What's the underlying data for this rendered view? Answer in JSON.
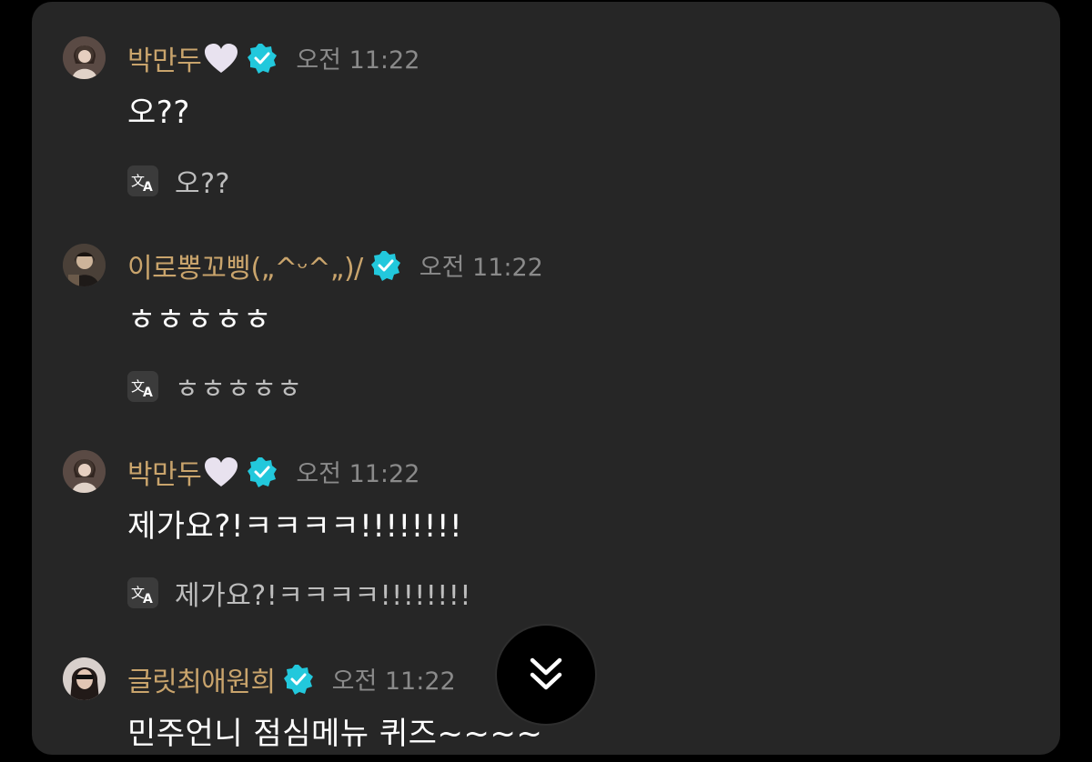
{
  "colors": {
    "background": "#000000",
    "panel": "#262626",
    "username": "#c9a46c",
    "timestamp": "#8a8a8a",
    "message": "#ffffff",
    "translation": "#bdbdbd",
    "verified_badge": "#22c8dc"
  },
  "messages": [
    {
      "username": "박만두",
      "has_heart": true,
      "verified": true,
      "time": "오전 11:22",
      "text": "오??",
      "translation": "오??"
    },
    {
      "username": "이로뽕꼬삥(„^ᵕ^„)/",
      "has_heart": false,
      "verified": true,
      "time": "오전 11:22",
      "text": "ㅎㅎㅎㅎㅎ",
      "translation": "ㅎㅎㅎㅎㅎ"
    },
    {
      "username": "박만두",
      "has_heart": true,
      "verified": true,
      "time": "오전 11:22",
      "text": "제가요?!ㅋㅋㅋㅋ!!!!!!!!",
      "translation": "제가요?!ㅋㅋㅋㅋ!!!!!!!!"
    },
    {
      "username": "글릿최애원희",
      "has_heart": false,
      "verified": true,
      "time": "오전 11:22",
      "text": "민주언니 점심메뉴 퀴즈~~~~",
      "translation": ""
    }
  ],
  "icons": {
    "heart": "white-heart-icon",
    "verified": "verified-badge-icon",
    "translate": "translate-icon",
    "scroll": "double-chevron-down-icon"
  }
}
